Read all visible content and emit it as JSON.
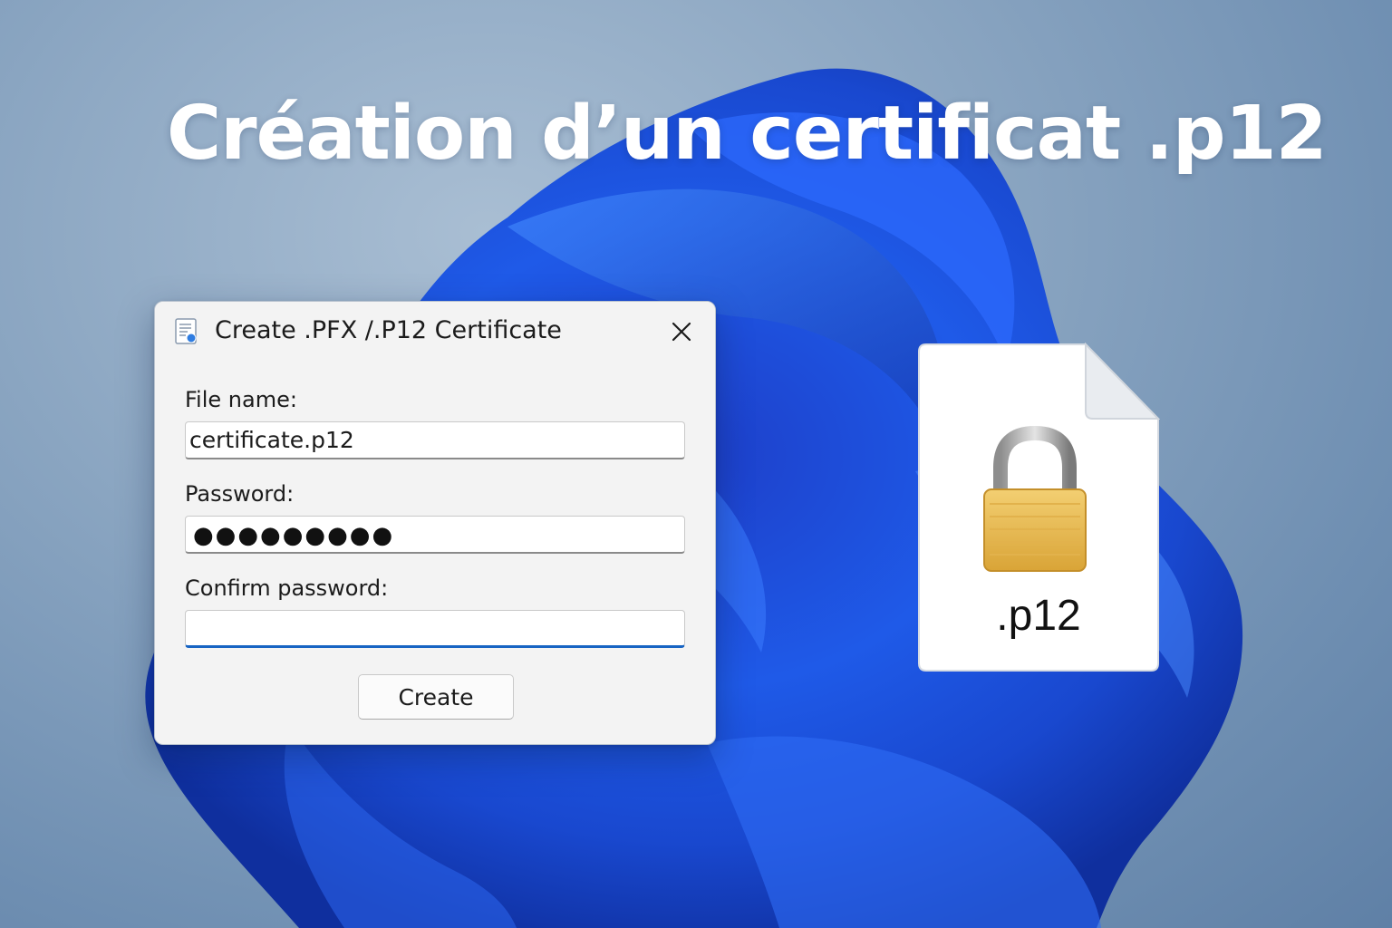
{
  "headline": "Création d’un certificat .p12",
  "dialog": {
    "title": "Create .PFX /.P12 Certificate",
    "close_icon": "close-icon",
    "title_icon": "certificate-icon",
    "file_name_label": "File name:",
    "file_name_value": "certificate.p12",
    "password_label": "Password:",
    "password_mask": "●●●●●●●●●",
    "confirm_label": "Confirm password:",
    "confirm_value": "",
    "create_label": "Create"
  },
  "file_icon": {
    "icon": "lock-icon",
    "extension": ".p12"
  },
  "colors": {
    "accent": "#1764c3",
    "bloom": "#1a4fd6",
    "lock_body": "#e8b84a"
  }
}
